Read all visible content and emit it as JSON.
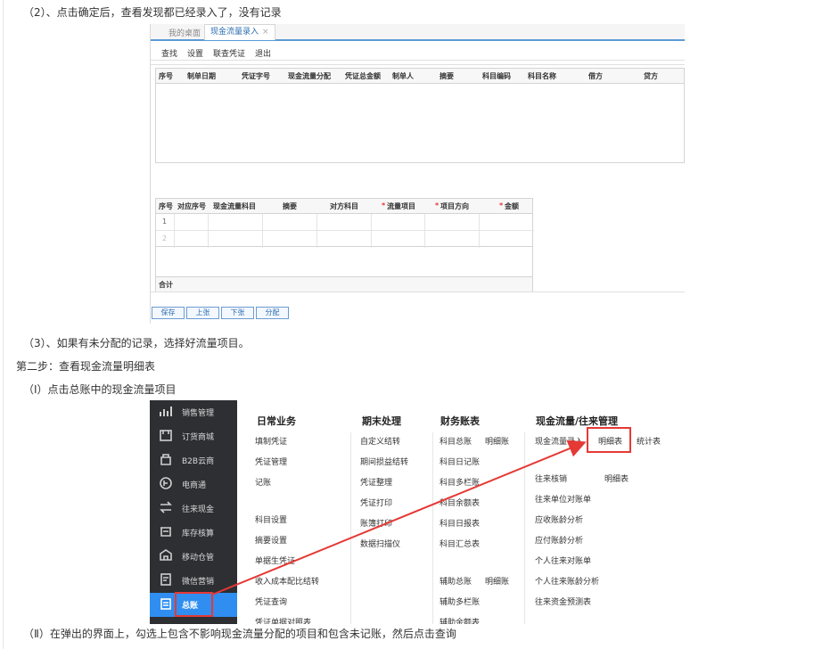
{
  "paragraphs": {
    "p1": "（2）、点击确定后，查看发现都已经录入了，没有记录",
    "p2": "（3）、如果有未分配的记录，选择好流量项目。",
    "p3": "第二步：查看现金流量明细表",
    "p4": "（Ⅰ）点击总账中的现金流量项目",
    "p5": "（Ⅱ）在弹出的界面上，勾选上包含不影响现金流量分配的项目和包含未记账，然后点击查询"
  },
  "entry_screen": {
    "tabs": {
      "desktop": "我的桌面",
      "active": "现金流量录入",
      "close": "×"
    },
    "menu": [
      "查找",
      "设置",
      "联查凭证",
      "退出"
    ],
    "top_headers": [
      "序号",
      "制单日期",
      "凭证字号",
      "现金流量分配",
      "凭证总金额",
      "制单人",
      "摘要",
      "科目编码",
      "科目名称",
      "借方",
      "贷方"
    ],
    "bottom_headers": [
      "序号",
      "对应序号",
      "现金流量科目",
      "摘要",
      "对方科目",
      "流量项目",
      "项目方向",
      "金额"
    ],
    "required_mark": "*",
    "rows": [
      "1",
      "2"
    ],
    "total_label": "合计",
    "buttons": [
      "保存",
      "上张",
      "下张",
      "分配"
    ]
  },
  "menu_screen": {
    "sidebar": [
      {
        "label": "销售管理",
        "icon": "chart-icon"
      },
      {
        "label": "订货商城",
        "icon": "store-icon"
      },
      {
        "label": "B2B云商",
        "icon": "cloud-shop-icon"
      },
      {
        "label": "电商通",
        "icon": "ecommerce-icon"
      },
      {
        "label": "往来现金",
        "icon": "exchange-icon"
      },
      {
        "label": "库存核算",
        "icon": "inventory-icon"
      },
      {
        "label": "移动仓管",
        "icon": "mobile-warehouse-icon"
      },
      {
        "label": "微信营销",
        "icon": "wechat-icon"
      },
      {
        "label": "总账",
        "icon": "ledger-icon"
      }
    ],
    "columns": {
      "daily": {
        "title": "日常业务",
        "items": [
          "填制凭证",
          "凭证管理",
          "记账",
          "科目设置",
          "摘要设置",
          "单据生凭证",
          "收入成本配比结转",
          "凭证查询",
          "凭证单据对照表"
        ]
      },
      "period_end": {
        "title": "期末处理",
        "items": [
          "自定义结转",
          "期间损益结转",
          "凭证整理",
          "凭证打印",
          "账簿打印",
          "数据扫描仪"
        ]
      },
      "books": {
        "title": "财务账表",
        "items": [
          "科目总账",
          "明细账",
          "科目日记账",
          "科目多栏账",
          "科目余额表",
          "科目日报表",
          "科目汇总表",
          "辅助总账",
          "明细账",
          "辅助多栏账",
          "辅助余额表"
        ]
      },
      "cashflow": {
        "title": "现金流量/往来管理",
        "items": [
          "现金流量录入",
          "明细表",
          "统计表",
          "往来核销",
          "明细表",
          "往来单位对账单",
          "应收账龄分析",
          "应付账龄分析",
          "个人往来对账单",
          "个人往来账龄分析",
          "往来资金预测表"
        ]
      }
    },
    "colors": {
      "sidebar_bg": "#2d2f33",
      "active_bg": "#2f8ef0",
      "highlight": "#e53935"
    }
  }
}
